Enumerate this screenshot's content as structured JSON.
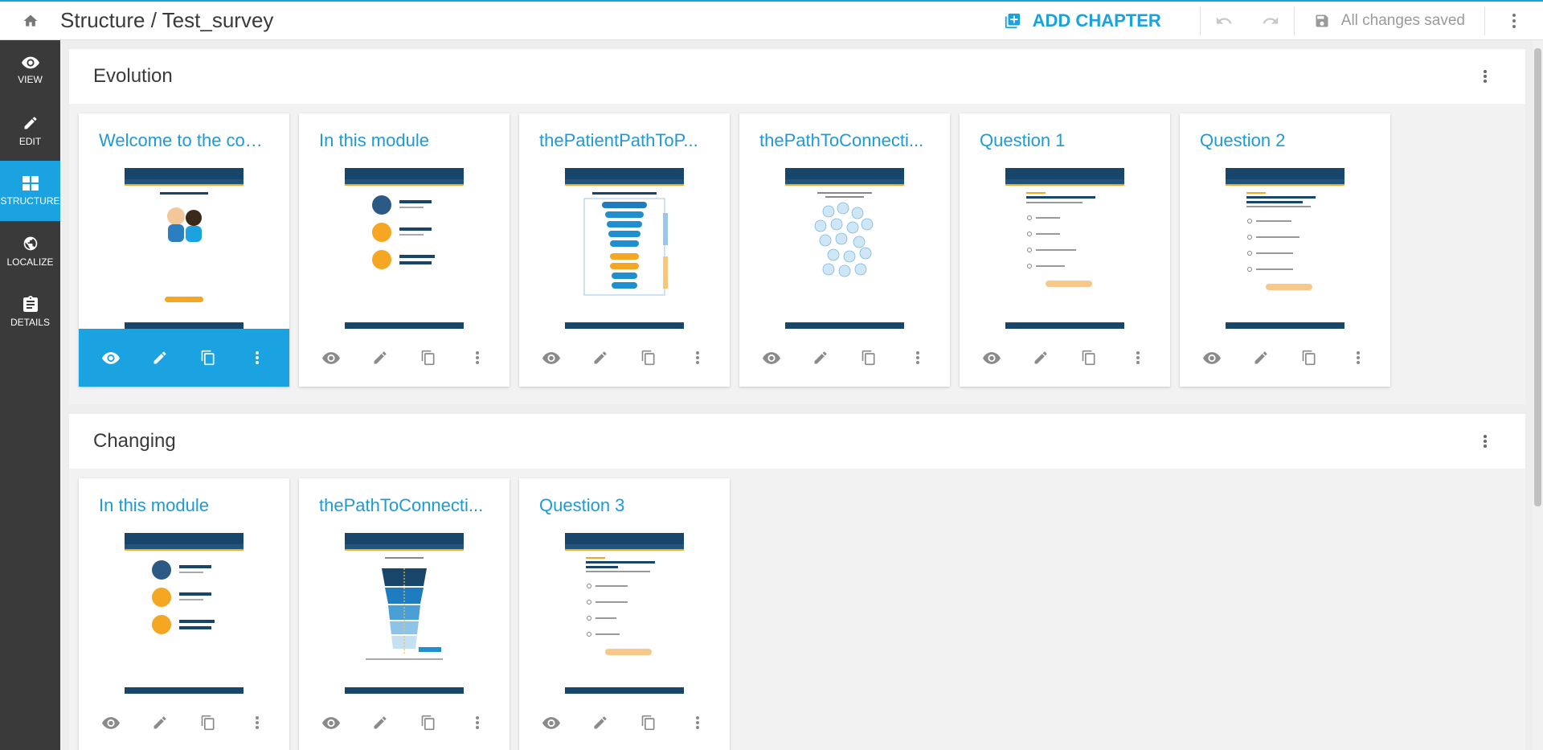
{
  "topbar": {
    "title": "Structure / Test_survey",
    "add_chapter_label": "ADD CHAPTER",
    "save_status": "All changes saved"
  },
  "sidebar": {
    "items": [
      {
        "label": "VIEW",
        "icon": "eye-icon"
      },
      {
        "label": "EDIT",
        "icon": "pencil-icon"
      },
      {
        "label": "STRUCTURE",
        "icon": "dashboard-icon"
      },
      {
        "label": "LOCALIZE",
        "icon": "globe-icon"
      },
      {
        "label": "DETAILS",
        "icon": "clipboard-icon"
      }
    ]
  },
  "colors": {
    "accent": "#1aa3e0",
    "sidebar": "#3a3a3a",
    "thumb_header": "#18466b",
    "highlight": "#f5a623"
  },
  "chapters": [
    {
      "title": "Evolution",
      "cards": [
        {
          "title": "Welcome to the cou...",
          "kind": "welcome"
        },
        {
          "title": "In this module",
          "kind": "module"
        },
        {
          "title": "thePatientPathToP...",
          "kind": "path"
        },
        {
          "title": "thePathToConnecti...",
          "kind": "bubbles"
        },
        {
          "title": "Question 1",
          "kind": "question"
        },
        {
          "title": "Question 2",
          "kind": "question"
        }
      ]
    },
    {
      "title": "Changing",
      "cards": [
        {
          "title": "In this module",
          "kind": "module"
        },
        {
          "title": "thePathToConnecti...",
          "kind": "funnel"
        },
        {
          "title": "Question 3",
          "kind": "question"
        }
      ]
    }
  ]
}
